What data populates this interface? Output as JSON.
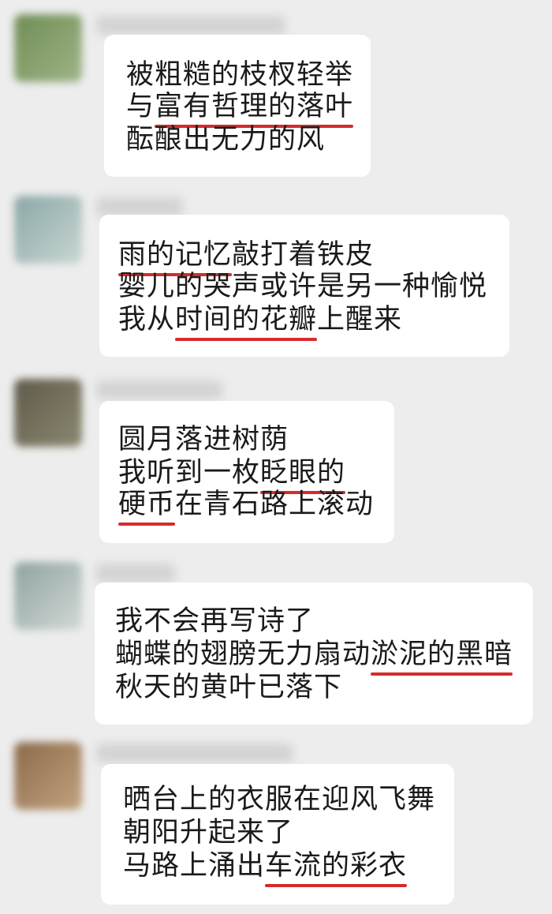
{
  "messages": [
    {
      "avatar_colors": [
        "#6f8d55",
        "#9fb487"
      ],
      "lines": [
        [
          {
            "t": "被粗糙的枝杈轻举"
          }
        ],
        [
          {
            "t": "与"
          },
          {
            "t": "富有哲理的落叶",
            "u": true
          }
        ],
        [
          {
            "t": "酝酿出无力的风"
          }
        ]
      ]
    },
    {
      "avatar_colors": [
        "#8aa7a5",
        "#c9d7d4"
      ],
      "lines": [
        [
          {
            "t": "雨的记忆",
            "u": true
          },
          {
            "t": "敲打着铁皮"
          }
        ],
        [
          {
            "t": "婴儿的哭声或许是另一种愉悦"
          }
        ],
        [
          {
            "t": "我从"
          },
          {
            "t": "时间的花瓣",
            "u": true
          },
          {
            "t": "上醒来"
          }
        ]
      ]
    },
    {
      "avatar_colors": [
        "#5f5a4a",
        "#8b8870"
      ],
      "lines": [
        [
          {
            "t": "圆月落进树荫"
          }
        ],
        [
          {
            "t": "我听到一枚"
          },
          {
            "t": "眨眼的",
            "u": true
          }
        ],
        [
          {
            "t": "硬币",
            "u": true
          },
          {
            "t": "在青石路上滚动"
          }
        ]
      ]
    },
    {
      "avatar_colors": [
        "#8fa3a0",
        "#d2d9d6"
      ],
      "lines": [
        [
          {
            "t": "我不会再写诗了"
          }
        ],
        [
          {
            "t": "蝴蝶的翅膀无力扇动"
          },
          {
            "t": "淤泥的黑暗",
            "u": true
          }
        ],
        [
          {
            "t": "秋天的黄叶已落下"
          }
        ]
      ]
    },
    {
      "avatar_colors": [
        "#8a6a4a",
        "#c2a27f"
      ],
      "lines": [
        [
          {
            "t": "晒台上的衣服在迎风飞舞"
          }
        ],
        [
          {
            "t": "朝阳升起来了"
          }
        ],
        [
          {
            "t": "马路上涌出"
          },
          {
            "t": "车流的彩衣",
            "u": true
          }
        ]
      ]
    }
  ]
}
